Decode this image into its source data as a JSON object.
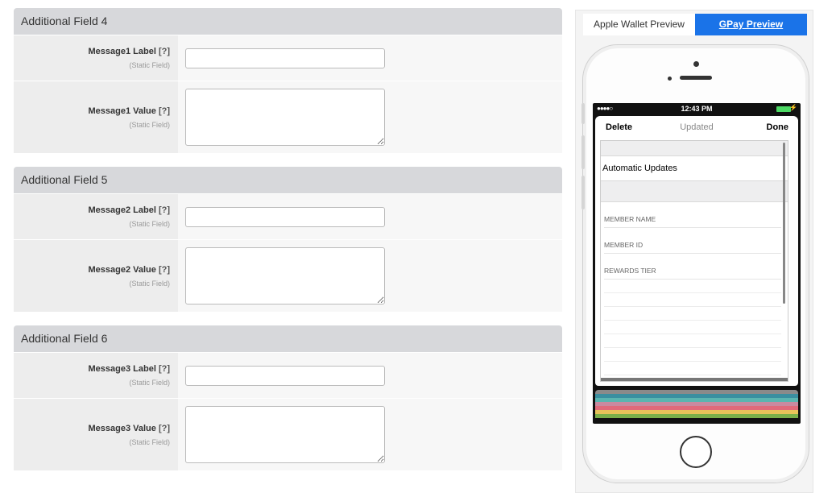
{
  "sections": [
    {
      "title": "Additional Field 4",
      "label_field": {
        "label": "Message1 Label",
        "help": "[?]",
        "sub": "(Static Field)",
        "value": ""
      },
      "value_field": {
        "label": "Message1 Value",
        "help": "[?]",
        "sub": "(Static Field)",
        "value": ""
      }
    },
    {
      "title": "Additional Field 5",
      "label_field": {
        "label": "Message2 Label",
        "help": "[?]",
        "sub": "(Static Field)",
        "value": ""
      },
      "value_field": {
        "label": "Message2 Value",
        "help": "[?]",
        "sub": "(Static Field)",
        "value": ""
      }
    },
    {
      "title": "Additional Field 6",
      "label_field": {
        "label": "Message3 Label",
        "help": "[?]",
        "sub": "(Static Field)",
        "value": ""
      },
      "value_field": {
        "label": "Message3 Value",
        "help": "[?]",
        "sub": "(Static Field)",
        "value": ""
      }
    }
  ],
  "preview": {
    "tabs": [
      {
        "label": "Apple Wallet Preview",
        "active": false
      },
      {
        "label": "GPay Preview",
        "active": true
      }
    ],
    "status": {
      "signal": "●●●●○",
      "time": "12:43 PM",
      "bolt": "⚡"
    },
    "nav": {
      "left": "Delete",
      "title": "Updated",
      "right": "Done"
    },
    "automatic_updates": "Automatic Updates",
    "fields": [
      "MEMBER NAME",
      "MEMBER ID",
      "REWARDS TIER"
    ],
    "colors": {
      "accent": "#1a73e8",
      "battery": "#4cd964"
    }
  }
}
